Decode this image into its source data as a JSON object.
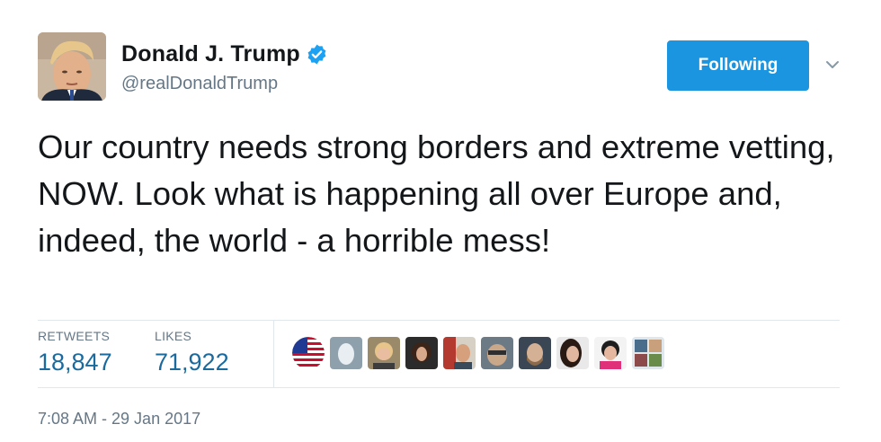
{
  "author": {
    "name": "Donald J. Trump",
    "handle": "@realDonaldTrump",
    "verified": true
  },
  "follow_button": {
    "label": "Following"
  },
  "tweet": {
    "text": "Our country needs strong borders and extreme vetting, NOW. Look what is happening all over Europe and, indeed, the world - a horrible mess!"
  },
  "stats": {
    "retweets_label": "RETWEETS",
    "retweets_value": "18,847",
    "likes_label": "LIKES",
    "likes_value": "71,922"
  },
  "likers": [
    {
      "kind": "flag-avatar"
    },
    {
      "kind": "default-avatar"
    },
    {
      "kind": "photo-avatar"
    },
    {
      "kind": "photo-avatar"
    },
    {
      "kind": "photo-avatar"
    },
    {
      "kind": "photo-avatar"
    },
    {
      "kind": "photo-avatar"
    },
    {
      "kind": "photo-avatar"
    },
    {
      "kind": "photo-avatar"
    },
    {
      "kind": "photo-avatar"
    }
  ],
  "timestamp": "7:08 AM - 29 Jan 2017",
  "colors": {
    "accent": "#1b95e0",
    "text": "#14171a",
    "secondary": "#657786",
    "divider": "#e1e8ed"
  }
}
